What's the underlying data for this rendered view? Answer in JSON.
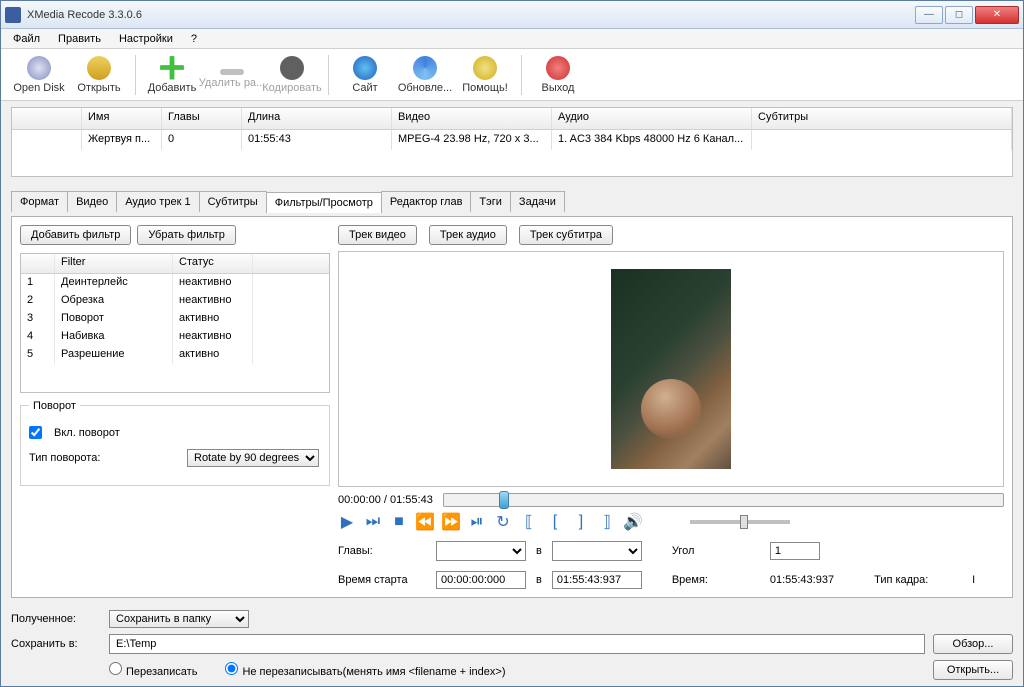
{
  "app": {
    "title": "XMedia Recode 3.3.0.6"
  },
  "menu": {
    "file": "Файл",
    "edit": "Править",
    "settings": "Настройки",
    "help": "?"
  },
  "toolbar": {
    "opendisk": "Open Disk",
    "open": "Открыть",
    "add": "Добавить",
    "removeall": "Удалить ра...",
    "encode": "Кодировать",
    "site": "Сайт",
    "update": "Обновле...",
    "help": "Помощь!",
    "exit": "Выход"
  },
  "grid": {
    "headers": {
      "name": "Имя",
      "chapters": "Главы",
      "length": "Длина",
      "video": "Видео",
      "audio": "Аудио",
      "subs": "Субтитры"
    },
    "row": {
      "name": "Жертвуя п...",
      "chapters": "0",
      "length": "01:55:43",
      "video": "MPEG-4 23.98 Hz, 720 x 3...",
      "audio": "1. AC3 384 Kbps 48000 Hz 6 Канал..."
    }
  },
  "tabs": {
    "format": "Формат",
    "video": "Видео",
    "audio": "Аудио трек 1",
    "subs": "Субтитры",
    "filters": "Фильтры/Просмотр",
    "chapters": "Редактор глав",
    "tags": "Тэги",
    "jobs": "Задачи"
  },
  "filters": {
    "add": "Добавить фильтр",
    "remove": "Убрать фильтр",
    "hdr_filter": "Filter",
    "hdr_status": "Статус",
    "rows": [
      {
        "n": "1",
        "name": "Деинтерлейс",
        "status": "неактивно"
      },
      {
        "n": "2",
        "name": "Обрезка",
        "status": "неактивно"
      },
      {
        "n": "3",
        "name": "Поворот",
        "status": "активно"
      },
      {
        "n": "4",
        "name": "Набивка",
        "status": "неактивно"
      },
      {
        "n": "5",
        "name": "Разрешение",
        "status": "активно"
      }
    ]
  },
  "rotate": {
    "legend": "Поворот",
    "enable": "Вкл. поворот",
    "type_label": "Тип поворота:",
    "type_value": "Rotate by 90 degrees"
  },
  "tracks": {
    "video": "Трек видео",
    "audio": "Трек аудио",
    "sub": "Трек субтитра"
  },
  "player": {
    "time": "00:00:00 / 01:55:43",
    "chapters_label": "Главы:",
    "v_label": "в",
    "angle_label": "Угол",
    "angle_value": "1",
    "start_label": "Время старта",
    "start_value": "00:00:00:000",
    "end_value": "01:55:43:937",
    "duration_label": "Время:",
    "duration_value": "01:55:43:937",
    "frametype_label": "Тип кадра:",
    "frametype_value": "I"
  },
  "bottom": {
    "received_label": "Полученное:",
    "received_value": "Сохранить в папку",
    "savein_label": "Сохранить в:",
    "savein_value": "E:\\Temp",
    "browse": "Обзор...",
    "open": "Открыть...",
    "overwrite": "Перезаписать",
    "no_overwrite": "Не перезаписывать(менять имя <filename + index>)"
  }
}
